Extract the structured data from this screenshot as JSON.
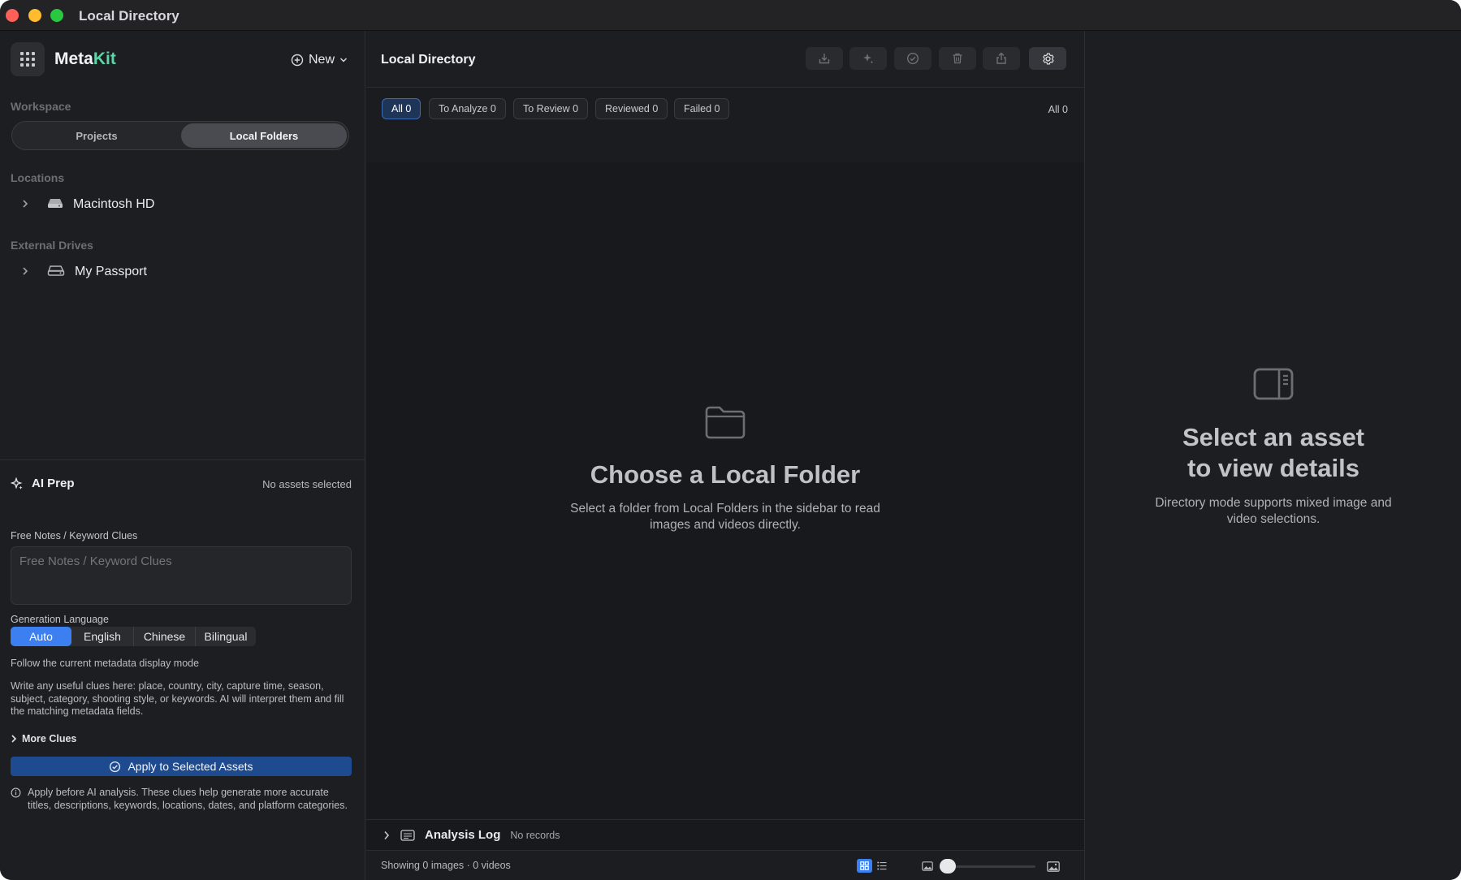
{
  "window": {
    "title": "Local Directory"
  },
  "sidebar": {
    "app_name_primary": "Meta",
    "app_name_accent": "Kit",
    "new_label": "New",
    "workspace_label": "Workspace",
    "workspace_tabs": [
      "Projects",
      "Local Folders"
    ],
    "workspace_active": "Local Folders",
    "locations_label": "Locations",
    "locations": [
      {
        "label": "Macintosh HD",
        "icon": "internal-drive-icon"
      }
    ],
    "external_label": "External Drives",
    "external_drives": [
      {
        "label": "My Passport",
        "icon": "external-drive-icon"
      }
    ]
  },
  "ai_prep": {
    "title": "AI Prep",
    "status": "No assets selected",
    "notes_label": "Free Notes / Keyword Clues",
    "notes_placeholder": "Free Notes / Keyword Clues",
    "language_label": "Generation Language",
    "languages": [
      "Auto",
      "English",
      "Chinese",
      "Bilingual"
    ],
    "language_active": "Auto",
    "language_hint": "Follow the current metadata display mode",
    "help_text": "Write any useful clues here: place, country, city, capture time, season, subject, category, shooting style, or keywords. AI will interpret them and fill the matching metadata fields.",
    "more_clues": "More Clues",
    "apply_button": "Apply to Selected Assets",
    "info_text": "Apply before AI analysis. These clues help generate more accurate titles, descriptions, keywords, locations, dates, and platform categories."
  },
  "main": {
    "title": "Local Directory",
    "toolbar_icons": [
      "import-icon",
      "sparkle-icon",
      "check-circle-icon",
      "trash-icon",
      "share-icon",
      "gear-icon"
    ],
    "filters": [
      "All 0",
      "To Analyze 0",
      "To Review 0",
      "Reviewed 0",
      "Failed 0"
    ],
    "filter_active": "All 0",
    "all_count": "All 0",
    "empty_title": "Choose a Local Folder",
    "empty_desc_line1": "Select a folder from Local Folders in the sidebar to read",
    "empty_desc_line2": "images and videos directly.",
    "log_title": "Analysis Log",
    "log_status": "No records",
    "status_text": "Showing 0 images · 0 videos",
    "view_mode": "grid",
    "thumbnail_zoom": 0
  },
  "detail": {
    "title_line1": "Select an asset",
    "title_line2": "to view details",
    "desc_line1": "Directory mode supports mixed image and",
    "desc_line2": "video selections."
  },
  "colors": {
    "accent_blue": "#3b7ff0",
    "brand_green": "#5fd6a8",
    "apply_button": "#1e4b8f"
  }
}
